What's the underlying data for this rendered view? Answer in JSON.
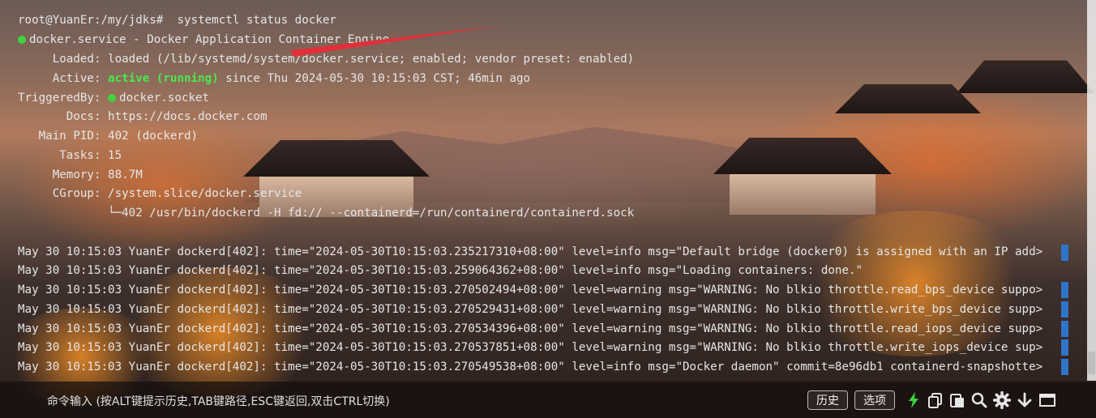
{
  "terminal": {
    "command_line": "root@YuanEr:/my/jdks#  systemctl status docker",
    "service_line": "docker.service - Docker Application Container Engine",
    "loaded_label": "     Loaded:",
    "loaded_value": " loaded (/lib/systemd/system/docker.service; enabled; vendor preset: enabled)",
    "active_label": "     Active:",
    "active_state": "active (running)",
    "active_rest": " since Thu 2024-05-30 10:15:03 CST; 46min ago",
    "triggered_label": "TriggeredBy:",
    "triggered_value": "docker.socket",
    "docs_line": "       Docs: https://docs.docker.com",
    "pid_line": "   Main PID: 402 (dockerd)",
    "tasks_line": "      Tasks: 15",
    "memory_line": "     Memory: 88.7M",
    "cgroup_line": "     CGroup: /system.slice/docker.service",
    "cgroup_child": "             └─402 /usr/bin/dockerd -H fd:// --containerd=/run/containerd/containerd.sock",
    "log_lines": [
      "May 30 10:15:03 YuanEr dockerd[402]: time=\"2024-05-30T10:15:03.235217310+08:00\" level=info msg=\"Default bridge (docker0) is assigned with an IP add>",
      "May 30 10:15:03 YuanEr dockerd[402]: time=\"2024-05-30T10:15:03.259064362+08:00\" level=info msg=\"Loading containers: done.\"",
      "May 30 10:15:03 YuanEr dockerd[402]: time=\"2024-05-30T10:15:03.270502494+08:00\" level=warning msg=\"WARNING: No blkio throttle.read_bps_device suppo>",
      "May 30 10:15:03 YuanEr dockerd[402]: time=\"2024-05-30T10:15:03.270529431+08:00\" level=warning msg=\"WARNING: No blkio throttle.write_bps_device supp>",
      "May 30 10:15:03 YuanEr dockerd[402]: time=\"2024-05-30T10:15:03.270534396+08:00\" level=warning msg=\"WARNING: No blkio throttle.read_iops_device supp>",
      "May 30 10:15:03 YuanEr dockerd[402]: time=\"2024-05-30T10:15:03.270537851+08:00\" level=warning msg=\"WARNING: No blkio throttle.write_iops_device sup>",
      "May 30 10:15:03 YuanEr dockerd[402]: time=\"2024-05-30T10:15:03.270549538+08:00\" level=info msg=\"Docker daemon\" commit=8e96db1 containerd-snapshotte>"
    ]
  },
  "bottom_bar": {
    "command_hint": "命令输入 (按ALT键提示历史,TAB键路径,ESC键返回,双击CTRL切换)",
    "history_button": "历史",
    "options_button": "选项",
    "tools": [
      "lightning-icon",
      "copy-icon",
      "paste-icon",
      "search-icon",
      "gear-icon",
      "download-icon",
      "window-icon"
    ]
  },
  "colors": {
    "active_green": "#4ce84c",
    "status_dot": "#3fd43f",
    "scroll_marker": "#2f74c8",
    "annotation_arrow": "#e0303a",
    "lightning": "#3fd43f"
  }
}
